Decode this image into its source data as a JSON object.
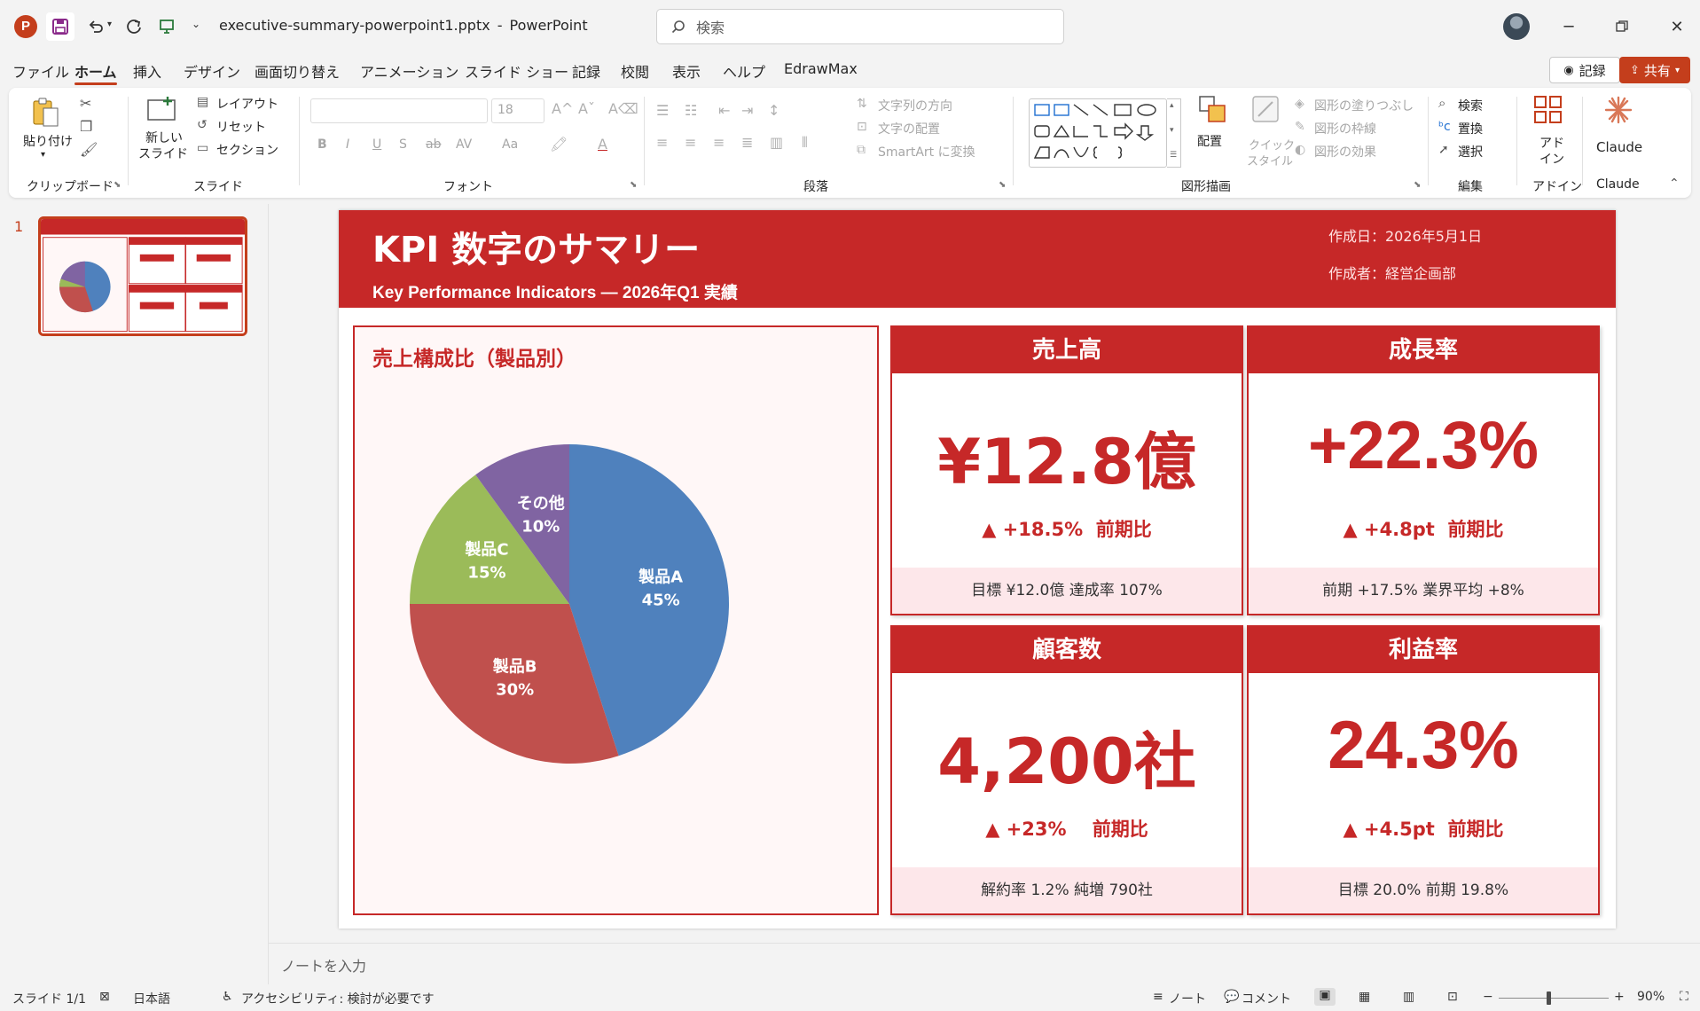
{
  "window": {
    "app_logo": "P",
    "filename": "executive-summary-powerpoint1.pptx",
    "separator": "-",
    "app_name": "PowerPoint",
    "search_placeholder": "検索"
  },
  "menu": {
    "tabs": [
      "ファイル",
      "ホーム",
      "挿入",
      "デザイン",
      "画面切り替え",
      "アニメーション",
      "スライド ショー",
      "記録",
      "校閲",
      "表示",
      "ヘルプ",
      "EdrawMax"
    ],
    "active_tab": "ホーム",
    "record_label": "記録",
    "share_label": "共有"
  },
  "ribbon": {
    "clipboard": {
      "paste": "貼り付け",
      "group": "クリップボード"
    },
    "slides": {
      "new_slide_1": "新しい",
      "new_slide_2": "スライド",
      "layout": "レイアウト",
      "reset": "リセット",
      "section": "セクション",
      "group": "スライド"
    },
    "font": {
      "name": "",
      "size": "18",
      "bold": "B",
      "italic": "I",
      "underline": "U",
      "shadow": "S",
      "strike": "ab",
      "spacing": "AV",
      "case": "Aa",
      "group": "フォント"
    },
    "paragraph": {
      "text_direction": "文字列の方向",
      "align_text": "文字の配置",
      "smartart": "SmartArt に変換",
      "group": "段落"
    },
    "drawing": {
      "arrange": "配置",
      "quick_styles_1": "クイック",
      "quick_styles_2": "スタイル",
      "fill": "図形の塗りつぶし",
      "outline": "図形の枠線",
      "effects": "図形の効果",
      "group": "図形描画"
    },
    "editing": {
      "find": "検索",
      "replace": "置換",
      "select": "選択",
      "group": "編集"
    },
    "addins": {
      "addin_1": "アド",
      "addin_2": "イン",
      "group": "アドイン"
    },
    "claude": {
      "button": "Claude",
      "group": "Claude"
    }
  },
  "thumbnail": {
    "number": "1"
  },
  "slide": {
    "title": "KPI 数字のサマリー",
    "subtitle": "Key Performance Indicators — 2026年Q1 実績",
    "date": "作成日：2026年5月1日",
    "author": "作成者：経営企画部",
    "pie_title": "売上構成比（製品別）",
    "cards": [
      {
        "title": "売上高",
        "value": "¥12.8億",
        "delta": "▲ +18.5%  前期比",
        "foot": "目標 ¥12.0億  達成率 107%"
      },
      {
        "title": "成長率",
        "value": "+22.3%",
        "delta": "▲ +4.8pt  前期比",
        "foot": "前期 +17.5%  業界平均 +8%"
      },
      {
        "title": "顧客数",
        "value": "4,200社",
        "delta": "▲ +23%    前期比",
        "foot": "解約率 1.2%  純増 790社"
      },
      {
        "title": "利益率",
        "value": "24.3%",
        "delta": "▲ +4.5pt  前期比",
        "foot": "目標 20.0%  前期 19.8%"
      }
    ]
  },
  "chart_data": {
    "type": "pie",
    "title": "売上構成比（製品別）",
    "categories": [
      "製品A",
      "製品B",
      "製品C",
      "その他"
    ],
    "values": [
      45,
      30,
      15,
      10
    ],
    "labels": [
      "45%",
      "30%",
      "15%",
      "10%"
    ],
    "colors": [
      "#4f81bd",
      "#c0504d",
      "#9bbb59",
      "#8064a2"
    ],
    "start": "12 o'clock, clockwise",
    "legend": "none (inside labels)"
  },
  "notes_placeholder": "ノートを入力",
  "status": {
    "slide_counter": "スライド 1/1",
    "language": "日本語",
    "accessibility": "アクセシビリティ: 検討が必要です",
    "notes": "ノート",
    "comments": "コメント",
    "zoom_level": "90%",
    "zoom_minus": "−",
    "zoom_plus": "+"
  },
  "colors": {
    "accent": "#c43e1c",
    "slide_red": "#c62828",
    "card_footer": "#fde7ea"
  }
}
